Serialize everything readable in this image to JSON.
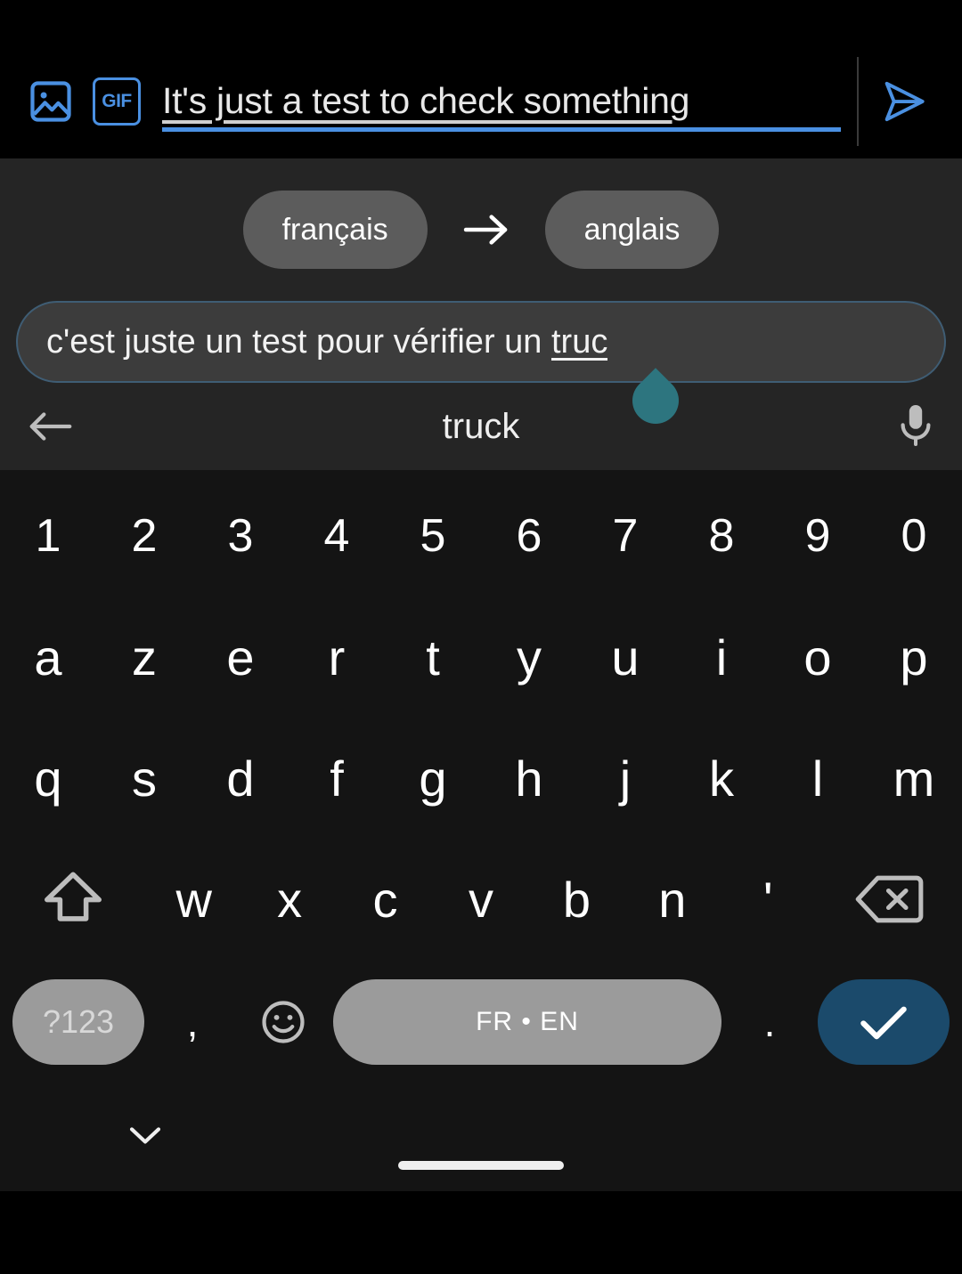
{
  "app": {
    "theme": "dark",
    "accent_blue": "#4a90e2",
    "enter_key_color": "#1b4a6b",
    "cursor_handle_color": "#2d757f",
    "key_gray": "#9b9b9b"
  },
  "compose": {
    "image_icon": "image-picker-icon",
    "gif_label": "GIF",
    "text": "It's just a test to check something",
    "send_icon": "send-icon"
  },
  "translate": {
    "source_language": "français",
    "target_language": "anglais",
    "arrow": "arrow-right-icon",
    "input_text_prefix": "c'est juste un test pour vérifier un ",
    "input_text_highlight": "truc"
  },
  "suggestion_bar": {
    "back_icon": "arrow-left-icon",
    "suggestion": "truck",
    "mic_icon": "microphone-icon"
  },
  "keyboard": {
    "layout": "AZERTY",
    "row_numbers": [
      "1",
      "2",
      "3",
      "4",
      "5",
      "6",
      "7",
      "8",
      "9",
      "0"
    ],
    "row_top": [
      "a",
      "z",
      "e",
      "r",
      "t",
      "y",
      "u",
      "i",
      "o",
      "p"
    ],
    "row_home": [
      "q",
      "s",
      "d",
      "f",
      "g",
      "h",
      "j",
      "k",
      "l",
      "m"
    ],
    "row_bottom": [
      "w",
      "x",
      "c",
      "v",
      "b",
      "n",
      "'"
    ],
    "shift_icon": "shift-icon",
    "backspace_icon": "backspace-icon",
    "symbols_label": "?123",
    "comma_label": ",",
    "emoji_icon": "emoji-icon",
    "space_label": "FR • EN",
    "period_label": ".",
    "enter_icon": "check-icon"
  },
  "navigation": {
    "hide_keyboard_icon": "chevron-down-icon",
    "home_indicator": "home-indicator"
  }
}
